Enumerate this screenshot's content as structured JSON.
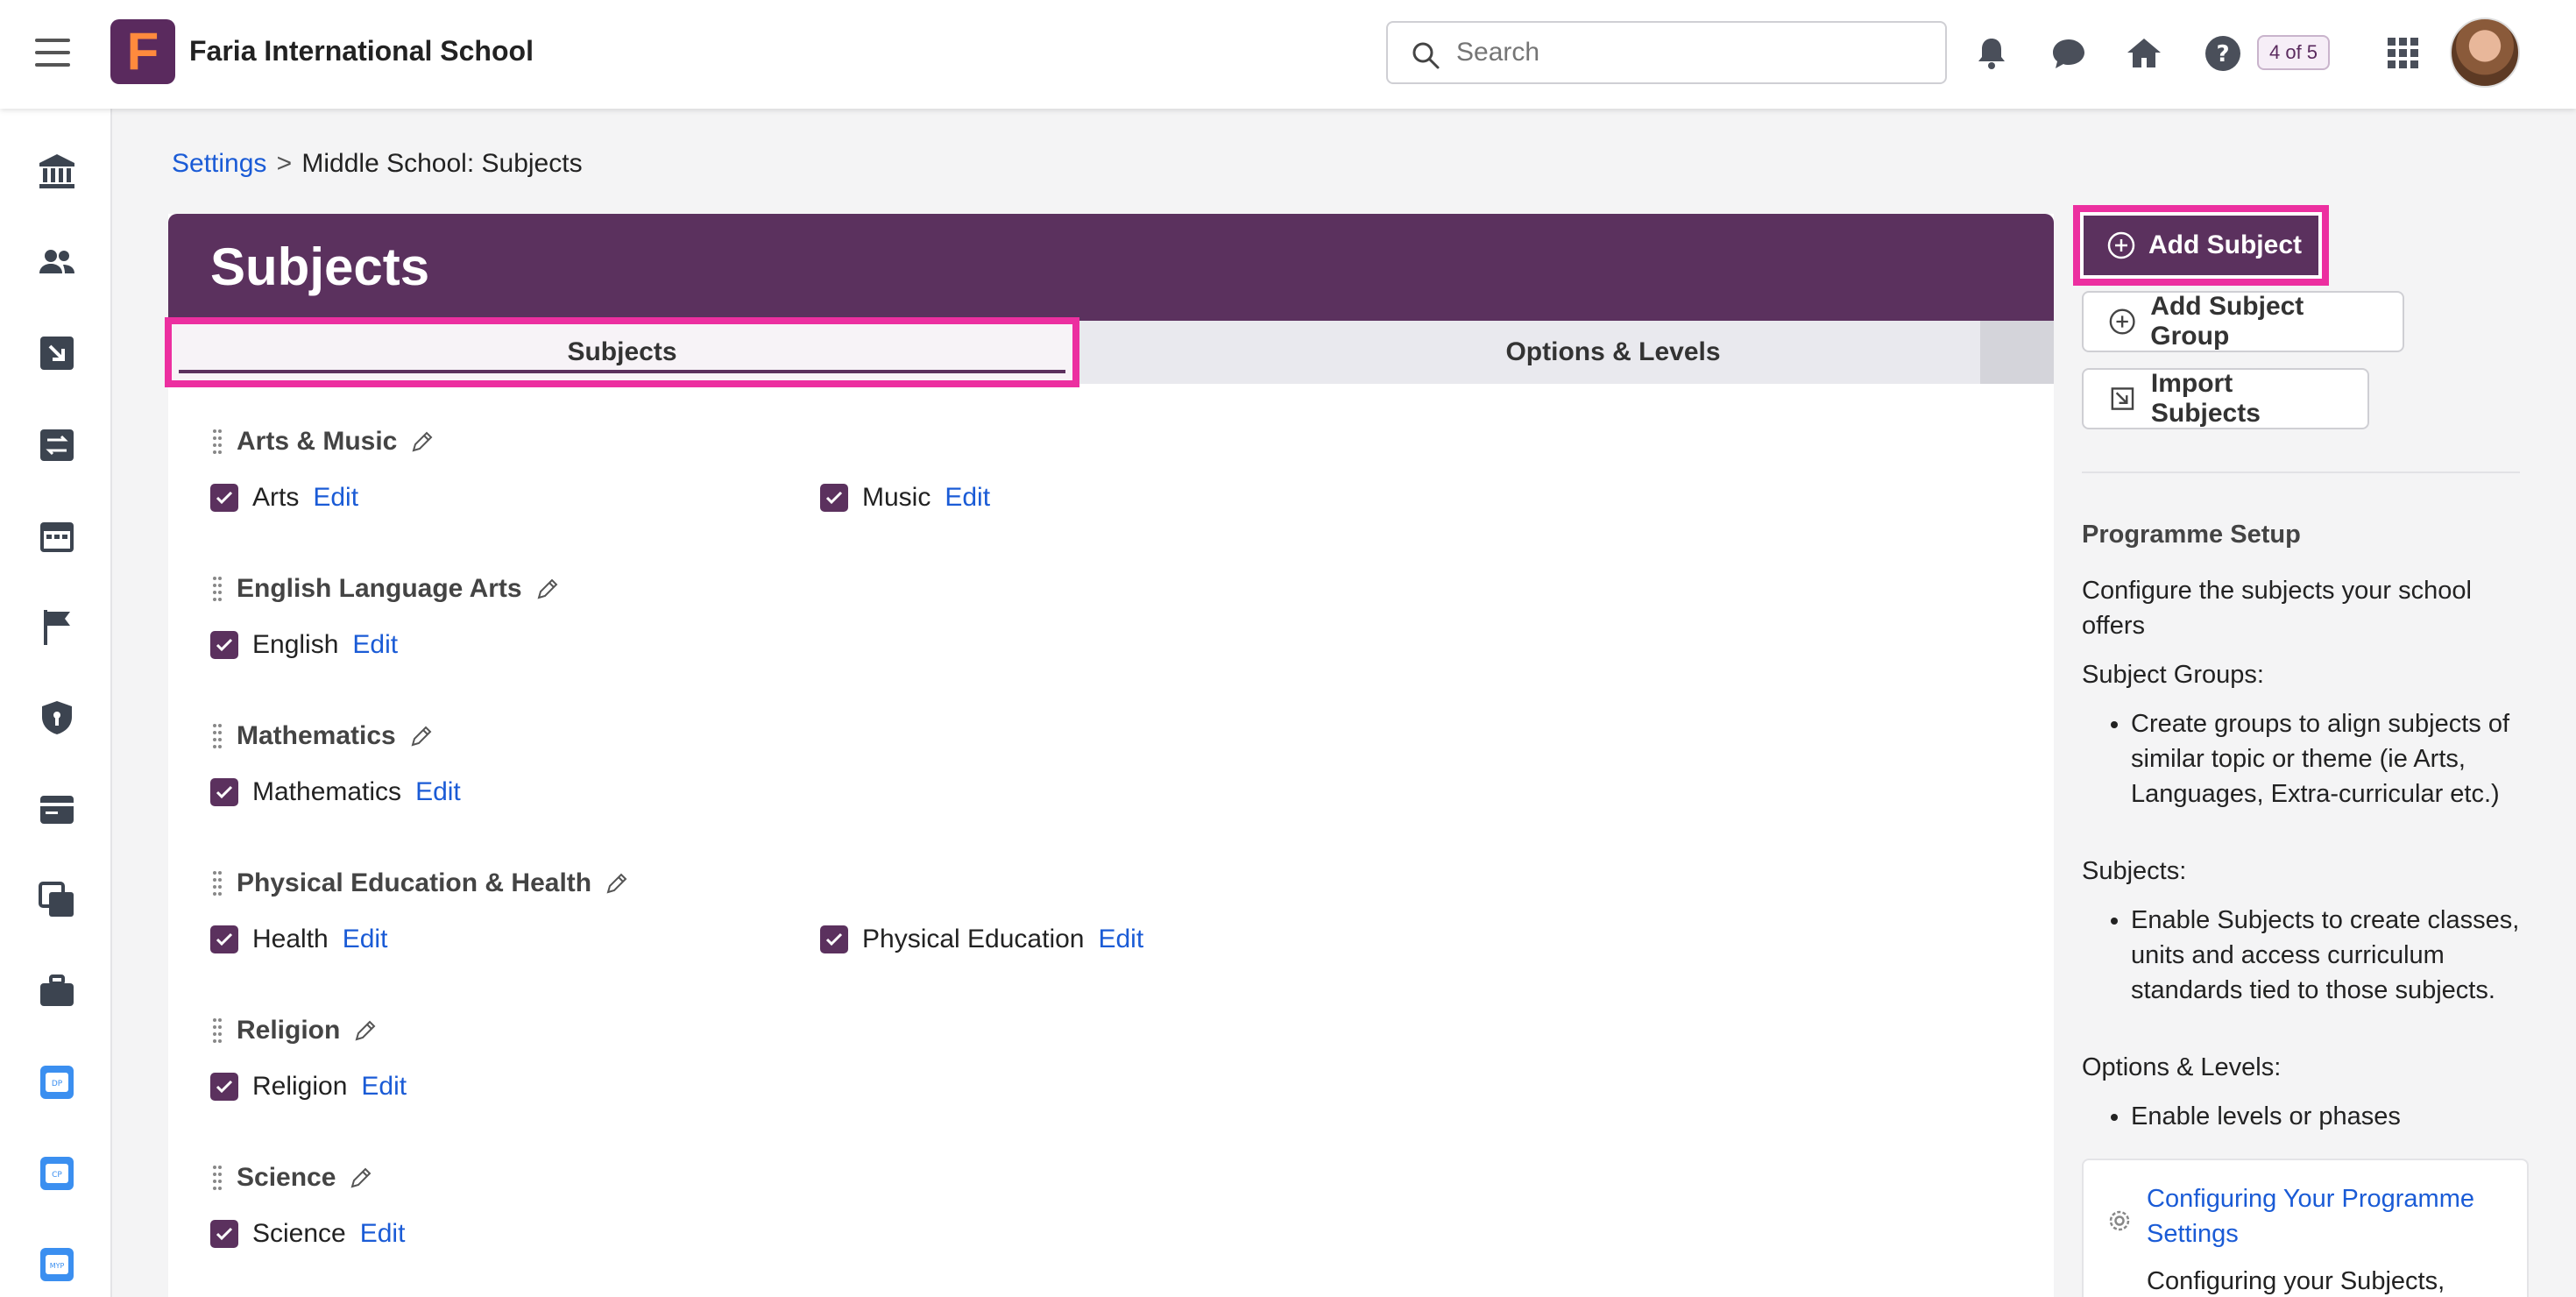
{
  "header": {
    "school_name": "Faria International School",
    "logo_letter": "F",
    "search_placeholder": "Search",
    "counter": "4 of 5"
  },
  "breadcrumb": {
    "parent": "Settings",
    "separator": ">",
    "current": "Middle School: Subjects"
  },
  "page": {
    "title": "Subjects",
    "tabs": [
      {
        "label": "Subjects",
        "active": true
      },
      {
        "label": "Options & Levels",
        "active": false
      }
    ]
  },
  "groups": [
    {
      "name": "Arts & Music",
      "subjects": [
        {
          "name": "Arts",
          "edit": "Edit"
        },
        {
          "name": "Music",
          "edit": "Edit"
        }
      ]
    },
    {
      "name": "English Language Arts",
      "subjects": [
        {
          "name": "English",
          "edit": "Edit"
        }
      ]
    },
    {
      "name": "Mathematics",
      "subjects": [
        {
          "name": "Mathematics",
          "edit": "Edit"
        }
      ]
    },
    {
      "name": "Physical Education & Health",
      "subjects": [
        {
          "name": "Health",
          "edit": "Edit"
        },
        {
          "name": "Physical Education",
          "edit": "Edit"
        }
      ]
    },
    {
      "name": "Religion",
      "subjects": [
        {
          "name": "Religion",
          "edit": "Edit"
        }
      ]
    },
    {
      "name": "Science",
      "subjects": [
        {
          "name": "Science",
          "edit": "Edit"
        }
      ]
    }
  ],
  "sidebar": {
    "add_subject": "Add Subject",
    "add_subject_group": "Add Subject Group",
    "import_subjects": "Import Subjects",
    "programme_setup": "Programme Setup",
    "configure_text": "Configure the subjects your school offers",
    "subject_groups_label": "Subject Groups:",
    "subject_groups_item": "Create groups to align subjects of similar topic or theme (ie Arts, Languages, Extra-curricular etc.)",
    "subjects_label": "Subjects:",
    "subjects_item": "Enable Subjects to create classes, units and access curriculum standards tied to those subjects.",
    "options_label": "Options & Levels:",
    "options_item": "Enable levels or phases",
    "help_link": "Configuring Your Programme Settings",
    "help_desc": "Configuring your Subjects,"
  },
  "colors": {
    "brand": "#5b315e",
    "highlight": "#ec2fa0",
    "link": "#1a5bd6"
  }
}
